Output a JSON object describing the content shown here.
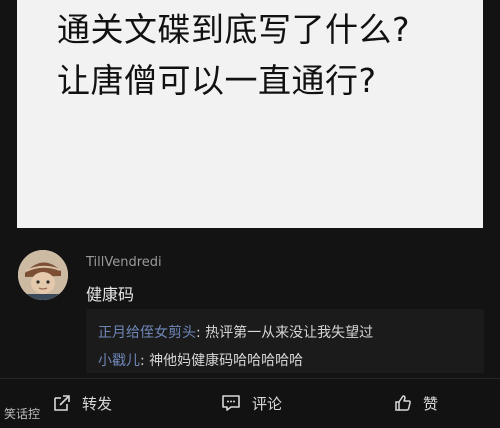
{
  "post": {
    "line1": "通关文碟到底写了什么?",
    "line2": "让唐僧可以一直通行?"
  },
  "comment": {
    "username": "TillVendredi",
    "text": "健康码"
  },
  "replies": [
    {
      "name": "正月给侄女剪头",
      "separator": ": ",
      "text": "热评第一从来没让我失望过"
    },
    {
      "name": "小戳儿",
      "separator": ": ",
      "text": "神他妈健康码哈哈哈哈哈"
    }
  ],
  "actions": {
    "share_label": "转发",
    "comment_label": "评论",
    "like_label": "赞"
  },
  "icons": {
    "share": "share-icon",
    "comment": "comment-icon",
    "like": "thumbs-up-icon"
  },
  "watermark": "笑话控"
}
